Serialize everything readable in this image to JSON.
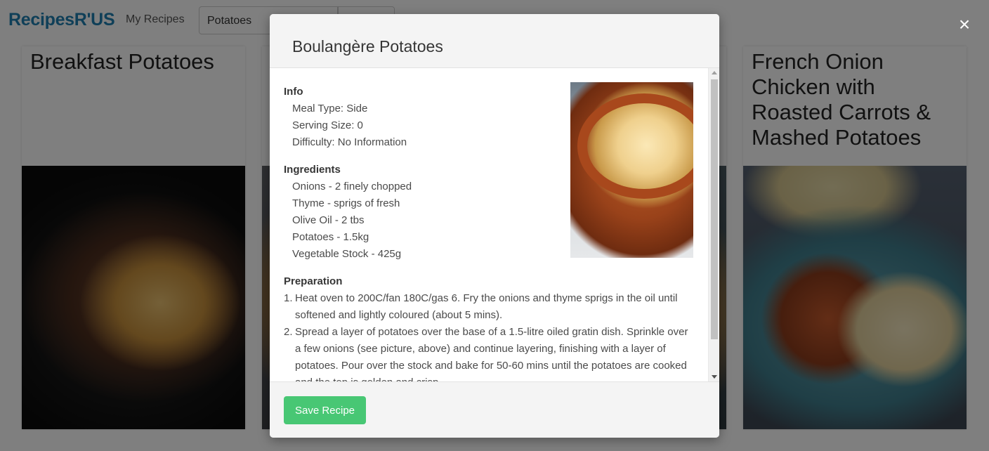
{
  "navbar": {
    "brand": "RecipesR'US",
    "my_recipes_label": "My Recipes",
    "search_value": "Potatoes",
    "search_button_label": ""
  },
  "cards": [
    {
      "title": "Breakfast Potatoes"
    },
    {
      "title": ""
    },
    {
      "title": ""
    },
    {
      "title": "French Onion Chicken with Roasted Carrots & Mashed Potatoes"
    }
  ],
  "overlay": {
    "close_icon": "×"
  },
  "modal": {
    "title": "Boulangère Potatoes",
    "info": {
      "heading": "Info",
      "meal_type": "Meal Type: Side",
      "serving_size": "Serving Size: 0",
      "difficulty": "Difficulty: No Information"
    },
    "ingredients": {
      "heading": "Ingredients",
      "items": [
        "Onions - 2 finely chopped",
        "Thyme - sprigs of fresh",
        "Olive Oil - 2 tbs",
        "Potatoes - 1.5kg",
        "Vegetable Stock - 425g"
      ]
    },
    "preparation": {
      "heading": "Preparation",
      "steps": [
        {
          "num": "1.",
          "text": "Heat oven to 200C/fan 180C/gas 6. Fry the onions and thyme sprigs in the oil until softened and lightly coloured (about 5 mins)."
        },
        {
          "num": "2.",
          "text": "Spread a layer of potatoes over the base of a 1.5-litre oiled gratin dish. Sprinkle over a few onions (see picture, above) and continue layering, finishing with a layer of potatoes. Pour over the stock and bake for 50-60 mins until the potatoes are cooked and the top is golden and crisp."
        }
      ]
    },
    "save_button_label": "Save Recipe"
  },
  "colors": {
    "brand": "#1e7fb1",
    "save_button": "#48c774",
    "backdrop": "rgba(0,0,0,0.5)"
  }
}
